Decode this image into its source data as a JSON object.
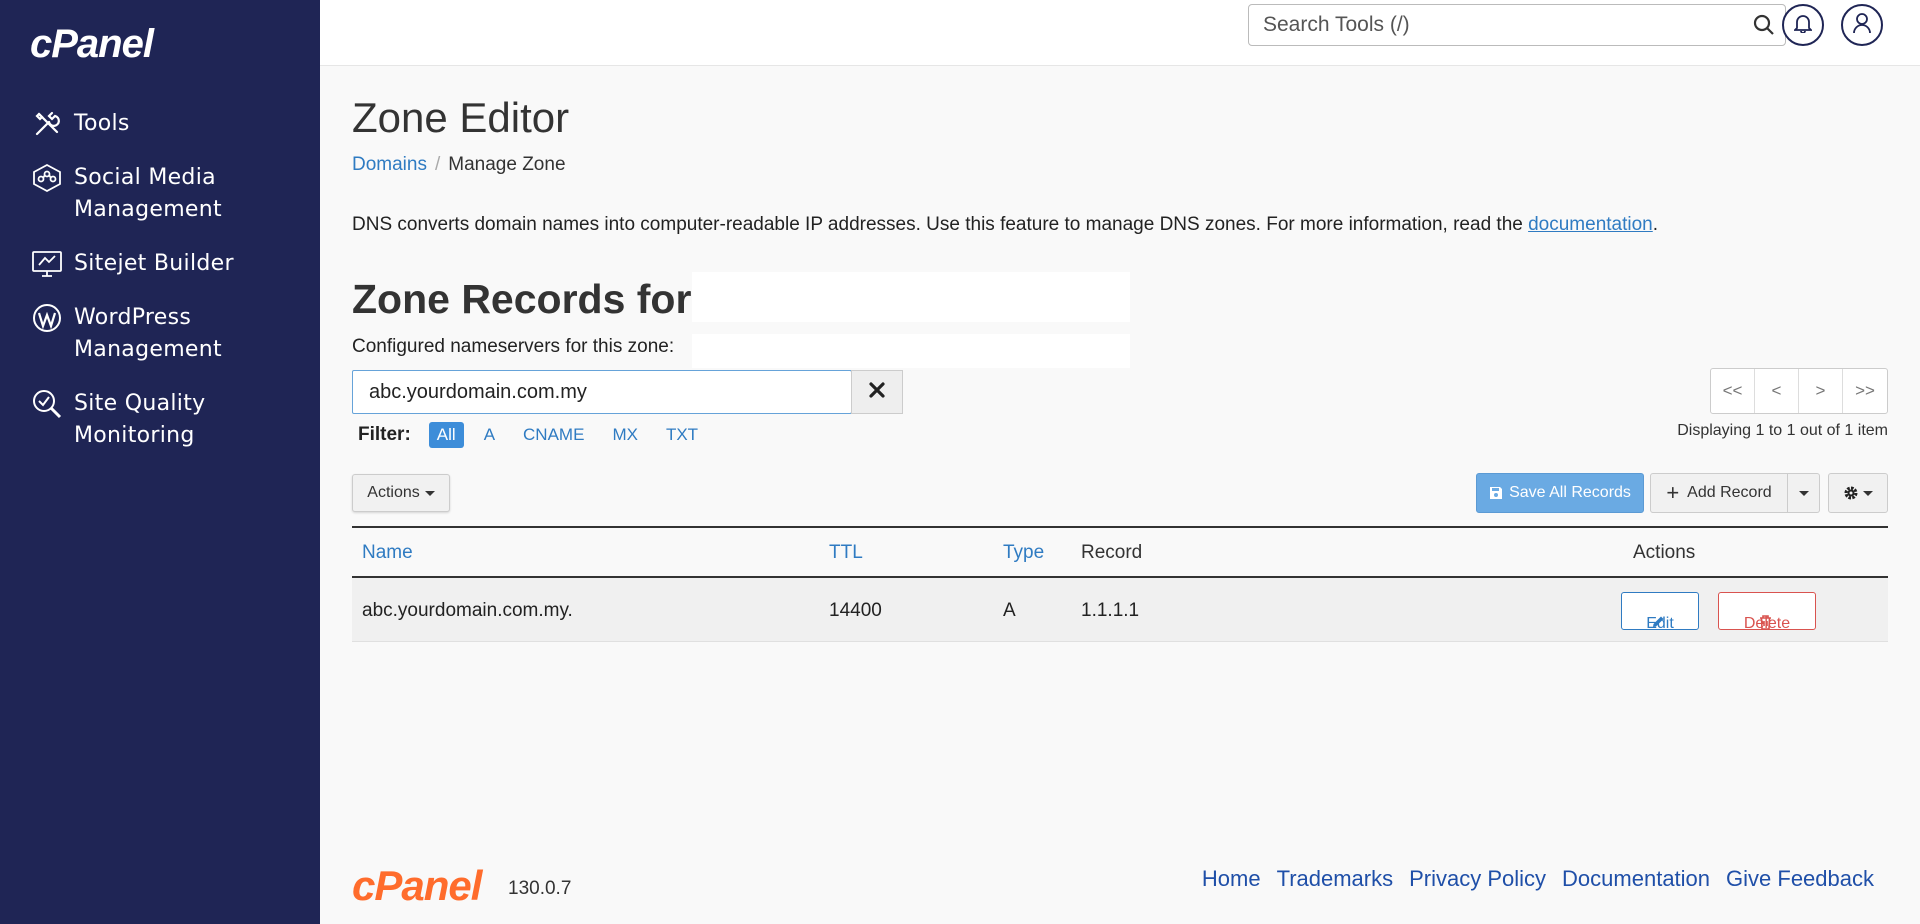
{
  "sidebar": {
    "logo": "cPanel",
    "items": [
      {
        "label": "Tools",
        "icon": "tools-icon"
      },
      {
        "label": "Social Media Management",
        "icon": "social-media-icon"
      },
      {
        "label": "Sitejet Builder",
        "icon": "sitejet-icon"
      },
      {
        "label": "WordPress Management",
        "icon": "wordpress-icon"
      },
      {
        "label": "Site Quality Monitoring",
        "icon": "site-quality-icon"
      }
    ]
  },
  "topbar": {
    "search_placeholder": "Search Tools (/)"
  },
  "page": {
    "title": "Zone Editor",
    "breadcrumb": {
      "parent": "Domains",
      "current": "Manage Zone"
    },
    "description_prefix": "DNS converts domain names into computer-readable IP addresses. Use this feature to manage DNS zones. For more information, read the ",
    "description_link": "documentation",
    "description_suffix": ".",
    "zone_title": "Zone Records for ‘",
    "nameservers_label": "Configured nameservers for this zone:"
  },
  "filter": {
    "search_value": "abc.yourdomain.com.my",
    "label": "Filter:",
    "options": [
      "All",
      "A",
      "CNAME",
      "MX",
      "TXT"
    ],
    "active": "All"
  },
  "pagination": {
    "first": "<<",
    "prev": "<",
    "next": ">",
    "last": ">>",
    "display_text": "Displaying 1 to 1 out of 1 item"
  },
  "toolbar": {
    "actions_label": "Actions",
    "save_all_label": "Save All Records",
    "add_record_label": "Add Record"
  },
  "table": {
    "headers": {
      "name": "Name",
      "ttl": "TTL",
      "type": "Type",
      "record": "Record",
      "actions": "Actions"
    },
    "rows": [
      {
        "name": "abc.yourdomain.com.my.",
        "ttl": "14400",
        "type": "A",
        "record": "1.1.1.1",
        "edit": "Edit",
        "delete": "Delete"
      }
    ]
  },
  "footer": {
    "logo": "cPanel",
    "version": "130.0.7",
    "links": [
      "Home",
      "Trademarks",
      "Privacy Policy",
      "Documentation",
      "Give Feedback"
    ]
  }
}
